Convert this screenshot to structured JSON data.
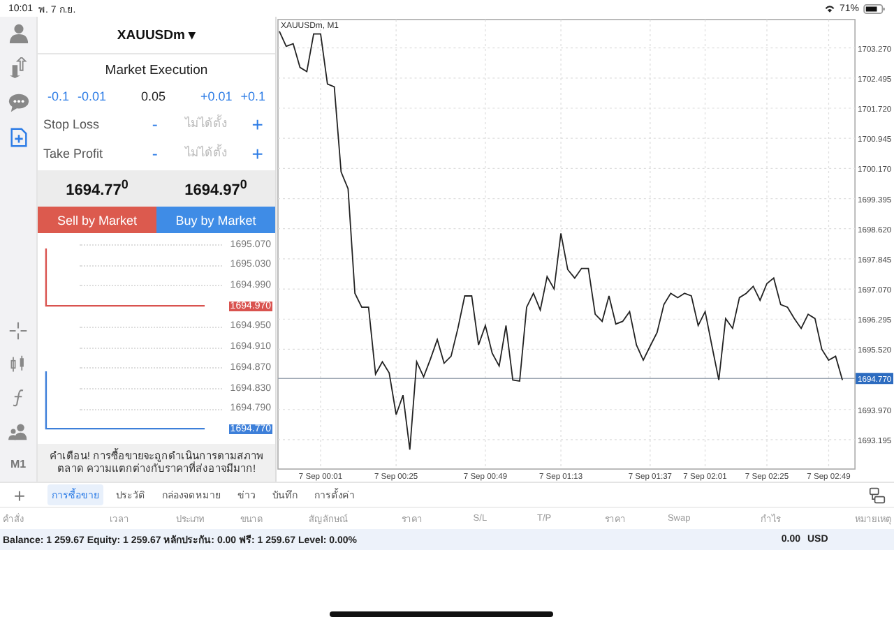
{
  "status_bar": {
    "time": "10:01",
    "date": "พ. 7 ก.ย.",
    "battery": "71%"
  },
  "sidebar": {
    "top": [
      {
        "kind": "person",
        "selected": false
      },
      {
        "kind": "arrows",
        "selected": false
      },
      {
        "kind": "chat",
        "selected": false
      },
      {
        "kind": "new-order",
        "selected": true
      }
    ],
    "bottom": [
      {
        "kind": "crosshair"
      },
      {
        "kind": "candles"
      },
      {
        "kind": "function"
      },
      {
        "kind": "people"
      },
      {
        "kind": "text",
        "label": "M1"
      }
    ]
  },
  "order": {
    "symbol": "XAUUSDm",
    "caret": "▾",
    "mode": "Market Execution",
    "steps_down": [
      "-0.1",
      "-0.01"
    ],
    "volume": "0.05",
    "steps_up": [
      "+0.01",
      "+0.1"
    ],
    "stops": [
      {
        "label": "Stop Loss",
        "minus": "-",
        "placeholder": "ไม่ได้ตั้ง",
        "plus": "+"
      },
      {
        "label": "Take Profit",
        "minus": "-",
        "placeholder": "ไม่ได้ตั้ง",
        "plus": "+"
      }
    ],
    "prices": [
      "1694.**77**$^{0}$",
      "1694.**97**$^{0}$"
    ],
    "buttons": [
      {
        "kind": "sell",
        "label": "Sell by Market"
      },
      {
        "kind": "buy",
        "label": "Buy by Market"
      }
    ],
    "ladder": [
      {
        "kind": "tick",
        "label": "1695.070"
      },
      {
        "kind": "tick",
        "label": "1695.030"
      },
      {
        "kind": "tick",
        "label": "1694.990"
      },
      {
        "kind": "ask",
        "label": "1694.970"
      },
      {
        "kind": "tick",
        "label": "1694.950"
      },
      {
        "kind": "tick",
        "label": "1694.910"
      },
      {
        "kind": "tick",
        "label": "1694.870"
      },
      {
        "kind": "tick",
        "label": "1694.830"
      },
      {
        "kind": "tick",
        "label": "1694.790"
      },
      {
        "kind": "bid",
        "label": "1694.770"
      }
    ],
    "warning": "คำเตือน! การซื้อขายจะถูกดำเนินการตามสภาพตลาด ความแตกต่างกับราคาที่ส่งอาจมีมาก!"
  },
  "chart": {
    "chart_data": {
      "type": "line",
      "title": "XAUUSDm, M1",
      "categories": [
        null,
        null,
        null,
        null,
        null,
        null,
        "7 Sep 00:01",
        null,
        null,
        null,
        null,
        null,
        null,
        null,
        null,
        null,
        null,
        "7 Sep 00:25",
        null,
        null,
        null,
        null,
        null,
        null,
        null,
        null,
        null,
        null,
        null,
        null,
        "7 Sep 00:49",
        null,
        null,
        null,
        null,
        null,
        null,
        null,
        null,
        null,
        null,
        "7 Sep 01:13",
        null,
        null,
        null,
        null,
        null,
        null,
        null,
        null,
        null,
        null,
        null,
        null,
        "7 Sep 01:37",
        null,
        null,
        null,
        null,
        null,
        null,
        null,
        "7 Sep 02:01",
        null,
        null,
        null,
        null,
        null,
        null,
        null,
        null,
        "7 Sep 02:25",
        null,
        null,
        null,
        null,
        null,
        null,
        null,
        null,
        "7 Sep 02:49",
        null,
        null
      ],
      "series": [
        {
          "color": "#222222",
          "values": [
            1703.7,
            1703.31,
            1703.38,
            1702.77,
            1702.66,
            1703.63,
            1703.63,
            1702.34,
            1702.27,
            1700.08,
            1699.65,
            1696.96,
            1696.6,
            1696.6,
            1694.88,
            1695.2,
            1694.91,
            1693.84,
            1694.34,
            1692.94,
            1695.2,
            1694.81,
            1695.27,
            1695.77,
            1695.16,
            1695.34,
            1696.06,
            1696.89,
            1696.89,
            1695.63,
            1696.13,
            1695.42,
            1695.09,
            1696.13,
            1694.73,
            1694.7,
            1696.6,
            1696.96,
            1696.53,
            1697.39,
            1697.07,
            1698.5,
            1697.57,
            1697.35,
            1697.6,
            1697.6,
            1696.42,
            1696.24,
            1696.89,
            1696.17,
            1696.24,
            1696.49,
            1695.63,
            1695.24,
            1695.6,
            1695.95,
            1696.67,
            1696.96,
            1696.85,
            1696.96,
            1696.89,
            1696.13,
            1696.49,
            1695.6,
            1694.73,
            1696.31,
            1696.06,
            1696.85,
            1696.96,
            1697.14,
            1696.78,
            1697.21,
            1697.35,
            1696.67,
            1696.6,
            1696.31,
            1696.06,
            1696.42,
            1696.31,
            1695.52,
            1695.24,
            1695.34,
            1694.73
          ]
        }
      ],
      "ylim": [
        1692.44,
        1704.0
      ],
      "grid": true,
      "yticks": [
        {
          "value": 1703.27,
          "label": "1703.270"
        },
        {
          "value": 1702.495,
          "label": "1702.495"
        },
        {
          "value": 1701.72,
          "label": "1701.720"
        },
        {
          "value": 1700.945,
          "label": "1700.945"
        },
        {
          "value": 1700.17,
          "label": "1700.170"
        },
        {
          "value": 1699.395,
          "label": "1699.395"
        },
        {
          "value": 1698.62,
          "label": "1698.620"
        },
        {
          "value": 1697.845,
          "label": "1697.845"
        },
        {
          "value": 1697.07,
          "label": "1697.070"
        },
        {
          "value": 1696.295,
          "label": "1696.295"
        },
        {
          "value": 1695.52,
          "label": "1695.520"
        },
        {
          "value": 1693.97,
          "label": "1693.970"
        },
        {
          "value": 1693.195,
          "label": "1693.195"
        }
      ],
      "ref_lines": [
        {
          "axis": "y",
          "value": 1694.77,
          "label": "1694.770"
        }
      ]
    }
  },
  "bottom": {
    "add": "+",
    "tabs": [
      {
        "label": "การซื้อขาย",
        "selected": true
      },
      {
        "label": "ประวัติ",
        "selected": false
      },
      {
        "label": "กล่องจดหมาย",
        "selected": false
      },
      {
        "label": "ข่าว",
        "selected": false
      },
      {
        "label": "บันทึก",
        "selected": false
      },
      {
        "label": "การตั้งค่า",
        "selected": false
      }
    ],
    "columns": [
      "คำสั่ง",
      "เวลา",
      "ประเภท",
      "ขนาด",
      "สัญลักษณ์",
      "ราคา",
      "S/L",
      "T/P",
      "ราคา",
      "Swap",
      "กำไร",
      "หมายเหตุ"
    ],
    "balance": "Balance: 1 259.67 Equity: 1 259.67 หลักประกัน: 0.00 ฟรี: 1 259.67 Level: 0.00%",
    "profit": "0.00",
    "currency": "USD"
  }
}
